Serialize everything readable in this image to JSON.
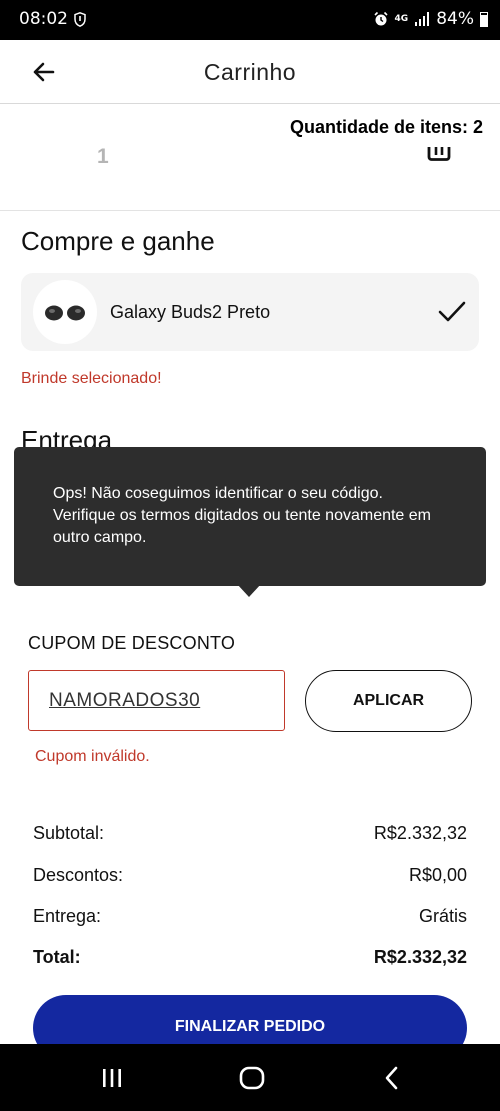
{
  "status": {
    "time": "08:02",
    "network": "4G",
    "battery": "84%"
  },
  "appbar": {
    "title": "Carrinho"
  },
  "cart": {
    "quantity_label": "Quantidade de itens: 2",
    "item_count": "1"
  },
  "gift": {
    "section_title": "Compre e ganhe",
    "product_name": "Galaxy Buds2 Preto",
    "selected_message": "Brinde selecionado!"
  },
  "delivery": {
    "section_title": "Entrega"
  },
  "tooltip": {
    "message": "Ops! Não coseguimos identificar o seu código. Verifique os termos digitados ou tente novamente em outro campo."
  },
  "coupon": {
    "label": "CUPOM DE DESCONTO",
    "value": "NAMORADOS30",
    "apply_label": "APLICAR",
    "error": "Cupom inválido."
  },
  "summary": {
    "subtotal_label": "Subtotal:",
    "subtotal_value": "R$2.332,32",
    "discounts_label": "Descontos:",
    "discounts_value": "R$0,00",
    "delivery_label": "Entrega:",
    "delivery_value": "Grátis",
    "total_label": "Total:",
    "total_value": "R$2.332,32"
  },
  "checkout": {
    "button_label": "FINALIZAR PEDIDO"
  },
  "colors": {
    "primary_button": "#1428a0",
    "error": "#c0392b",
    "tooltip_bg": "#2d2d2d"
  },
  "icons": {
    "back": "arrow-left-icon",
    "trash": "trash-icon",
    "check": "check-icon",
    "nav_recents": "recents-icon",
    "nav_home": "home-icon",
    "nav_back": "nav-back-icon"
  }
}
